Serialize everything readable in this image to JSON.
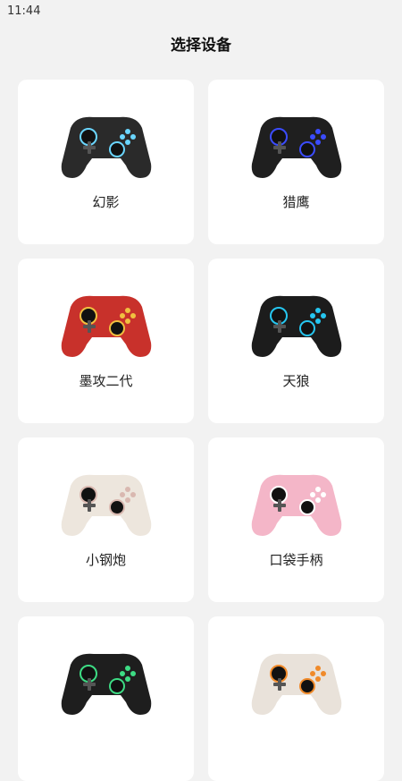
{
  "status": {
    "time": "11:44"
  },
  "page": {
    "title": "选择设备"
  },
  "devices": [
    {
      "name": "幻影",
      "icon": "gamepad-transparent-rgb-icon",
      "body": "#2a2a2a",
      "accent": "#6ad6ff"
    },
    {
      "name": "猎鹰",
      "icon": "gamepad-black-blue-icon",
      "body": "#1f1f1f",
      "accent": "#3b4cff"
    },
    {
      "name": "墨攻二代",
      "icon": "gamepad-red-white-icon",
      "body": "#c8312b",
      "accent": "#f0c040"
    },
    {
      "name": "天狼",
      "icon": "gamepad-black-xbox-icon",
      "body": "#1c1c1c",
      "accent": "#26c6f0"
    },
    {
      "name": "小钢炮",
      "icon": "gamepad-cream-icon",
      "body": "#ede6dd",
      "accent": "#d9b8b0"
    },
    {
      "name": "口袋手柄",
      "icon": "gamepad-pink-mini-icon",
      "body": "#f4b6c8",
      "accent": "#ffffff"
    },
    {
      "name": "",
      "icon": "gamepad-black-green-icon",
      "body": "#1e1e1e",
      "accent": "#3ddc84"
    },
    {
      "name": "",
      "icon": "gamepad-orange-blue-icon",
      "body": "#e9e2da",
      "accent": "#f08a2a"
    }
  ]
}
